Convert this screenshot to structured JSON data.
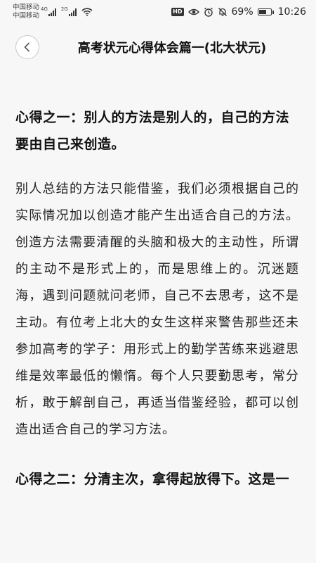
{
  "status_bar": {
    "carrier_1": "中国移动",
    "carrier_2": "中国移动",
    "net_1": "4G",
    "net_2": "2G",
    "hd": "HD",
    "battery_percent": "69%",
    "battery_level": 0.69,
    "time": "10:26"
  },
  "header": {
    "title": "高考状元心得体会篇一(北大状元)"
  },
  "article": {
    "heading_1": "心得之一：别人的方法是别人的，自己的方法要由自己来创造。",
    "paragraph_1": "别人总结的方法只能借鉴，我们必须根据自己的实际情况加以创造才能产生出适合自己的方法。创造方法需要清醒的头脑和极大的主动性，所谓的主动不是形式上的，而是思维上的。沉迷题海，遇到问题就问老师，自己不去思考，这不是主动。有位考上北大的女生这样来警告那些还未参加高考的学子：用形式上的勤学苦练来逃避思维是效率最低的懒惰。每个人只要勤思考，常分析，敢于解剖自己，再适当借鉴经验，都可以创造出适合自己的学习方法。",
    "heading_2": "心得之二：分清主次，拿得起放得下。这是一"
  }
}
